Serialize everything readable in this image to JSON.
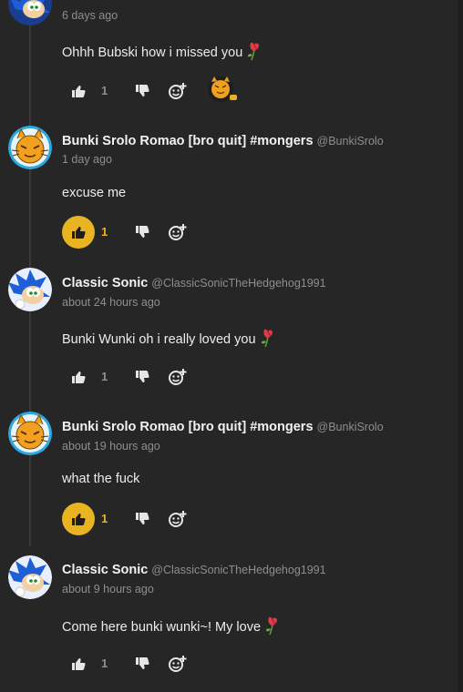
{
  "colors": {
    "background": "#262626",
    "accent": "#e8b422",
    "muted": "#8e8e8e",
    "text": "#ececec"
  },
  "top_comment": {
    "time": "6 days ago",
    "text": "Ohhh Bubski how i missed you",
    "like_count": "1",
    "liked": false,
    "reaction_icon": "orange-cat-emoji"
  },
  "comments": [
    {
      "name": "Bunki Srolo Romao [bro quit] #mongers",
      "handle": "@BunkiSrolo",
      "time": "1 day ago",
      "text": "excuse me",
      "like_count": "1",
      "liked": true,
      "avatar": "orange-cat-avatar"
    },
    {
      "name": "Classic Sonic",
      "handle": "@ClassicSonicTheHedgehog1991",
      "time": "about 24 hours ago",
      "text": "Bunki Wunki oh i really loved you",
      "like_count": "1",
      "liked": false,
      "avatar": "sonic-avatar"
    },
    {
      "name": "Bunki Srolo Romao [bro quit] #mongers",
      "handle": "@BunkiSrolo",
      "time": "about 19 hours ago",
      "text": "what the fuck",
      "like_count": "1",
      "liked": true,
      "avatar": "orange-cat-avatar"
    },
    {
      "name": "Classic Sonic",
      "handle": "@ClassicSonicTheHedgehog1991",
      "time": "about 9 hours ago",
      "text": "Come here bunki wunki~! My love",
      "like_count": "1",
      "liked": false,
      "avatar": "sonic-avatar"
    }
  ]
}
